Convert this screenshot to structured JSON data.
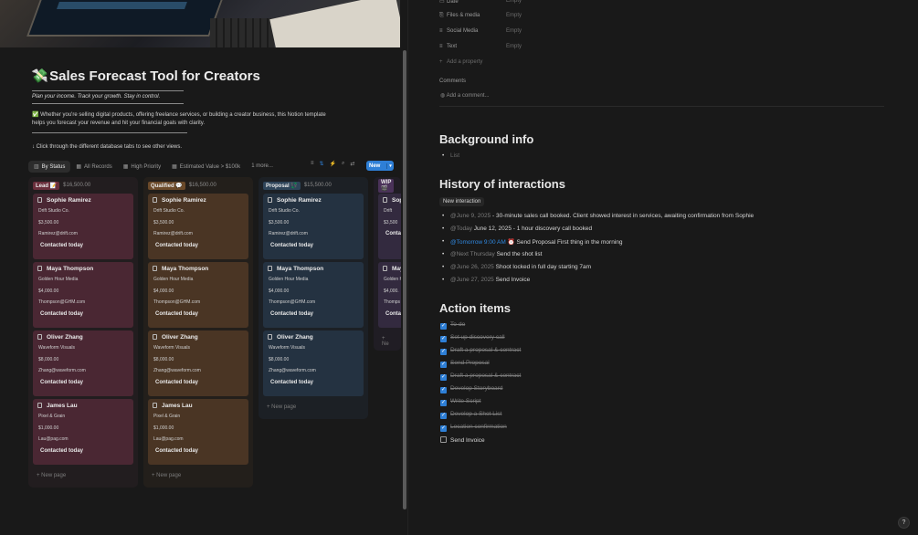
{
  "doc": {
    "title": "Sales Forecast Tool for Creators",
    "tagline": "Plan your income. Track your growth. Stay in control.",
    "description": "Whether you're selling digital products, offering freelance services, or building a creator business, this Notion template helps you forecast your revenue and hit your financial goals with clarity.",
    "hint": "↓ Click through the different database tabs to see other views."
  },
  "tabs": [
    {
      "label": "By Status",
      "icon": "board-icon"
    },
    {
      "label": "All Records",
      "icon": "table-icon"
    },
    {
      "label": "High Priority",
      "icon": "table-icon"
    },
    {
      "label": "Estimated Value > $100k",
      "icon": "table-icon"
    },
    {
      "label": "1 more...",
      "icon": ""
    }
  ],
  "toolbar": {
    "new_label": "New"
  },
  "columns": [
    {
      "label": "Lead 📝",
      "sum": "$16,500.00",
      "pill": "#6a2f3c",
      "card": "#4a2733",
      "bg": "#221d1f",
      "cards": [
        {
          "name": "Sophie Ramirez",
          "company": "Drift Studio Co.",
          "value": "$3,500.00",
          "email": "Ramirez@drift.com",
          "contact": "Contacted today"
        },
        {
          "name": "Maya Thompson",
          "company": "Golden Hour Media",
          "value": "$4,000.00",
          "email": "Thompson@GHM.com",
          "contact": "Contacted today"
        },
        {
          "name": "Oliver Zhang",
          "company": "Waveform Visuals",
          "value": "$8,000.00",
          "email": "Zhang@waveform.com",
          "contact": "Contacted today"
        },
        {
          "name": "James Lau",
          "company": "Pixel & Grain",
          "value": "$1,000.00",
          "email": "Lau@pag.com",
          "contact": "Contacted today"
        }
      ],
      "new_page": "New page"
    },
    {
      "label": "Qualified 💬",
      "sum": "$16,500.00",
      "pill": "#6b4a2a",
      "card": "#4a3524",
      "bg": "#231f1b",
      "cards": [
        {
          "name": "Sophie Ramirez",
          "company": "Drift Studio Co.",
          "value": "$3,500.00",
          "email": "Ramirez@drift.com",
          "contact": "Contacted today"
        },
        {
          "name": "Maya Thompson",
          "company": "Golden Hour Media",
          "value": "$4,000.00",
          "email": "Thompson@GHM.com",
          "contact": "Contacted today"
        },
        {
          "name": "Oliver Zhang",
          "company": "Waveform Visuals",
          "value": "$8,000.00",
          "email": "Zhang@waveform.com",
          "contact": "Contacted today"
        },
        {
          "name": "James Lau",
          "company": "Pixel & Grain",
          "value": "$1,000.00",
          "email": "Lau@pag.com",
          "contact": "Contacted today"
        }
      ],
      "new_page": "New page"
    },
    {
      "label": "Proposal 💱",
      "sum": "$15,500.00",
      "pill": "#2e4459",
      "card": "#243241",
      "bg": "#1c2025",
      "cards": [
        {
          "name": "Sophie Ramirez",
          "company": "Drift Studio Co.",
          "value": "$3,500.00",
          "email": "Ramirez@drift.com",
          "contact": "Contacted today"
        },
        {
          "name": "Maya Thompson",
          "company": "Golden Hour Media",
          "value": "$4,000.00",
          "email": "Thompson@GHM.com",
          "contact": "Contacted today"
        },
        {
          "name": "Oliver Zhang",
          "company": "Waveform Visuals",
          "value": "$8,000.00",
          "email": "Zhang@waveform.com",
          "contact": "Contacted today"
        }
      ],
      "new_page": "New page"
    },
    {
      "label": "WIP 🎬",
      "sum": "",
      "pill": "#4a3259",
      "card": "#332a3f",
      "bg": "#201d24",
      "cards": [
        {
          "name": "Sop",
          "company": "Drift",
          "value": "$3,500",
          "email": "",
          "contact": "Conta"
        },
        {
          "name": "May",
          "company": "Golden H",
          "value": "$4,000.",
          "email": "Thomps",
          "contact": "Conta"
        }
      ],
      "new_page": "Ne"
    }
  ],
  "properties": [
    {
      "label": "Date",
      "value": "Empty",
      "icon": "calendar-icon"
    },
    {
      "label": "Files & media",
      "value": "Empty",
      "icon": "paperclip-icon"
    },
    {
      "label": "Social Media",
      "value": "Empty",
      "icon": "lines-icon"
    },
    {
      "label": "Text",
      "value": "Empty",
      "icon": "lines-icon"
    }
  ],
  "add_property": "Add a property",
  "comments": {
    "heading": "Comments",
    "placeholder": "Add a comment..."
  },
  "background": {
    "heading": "Background info",
    "items": [
      "List"
    ]
  },
  "history": {
    "heading": "History of interactions",
    "button": "New interaction",
    "items": [
      {
        "at": "@June 9, 2025",
        "text": "- 30-minute sales call booked. Client showed interest in services, awaiting confirmation from Sophie"
      },
      {
        "at": "@Today",
        "text": "June 12, 2025 - 1 hour discovery call booked"
      },
      {
        "at": "@Tomorrow 9:00 AM ⏰",
        "text": "Send Proposal First thing in the morning"
      },
      {
        "at": "@Next Thursday",
        "text": "Send the shot list"
      },
      {
        "at": "@June 26, 2025",
        "text": "Shoot locked in full day starting 7am"
      },
      {
        "at": "@June 27, 2025",
        "text": "Send Invoice"
      }
    ]
  },
  "actions": {
    "heading": "Action items",
    "items": [
      {
        "label": "To-do",
        "done": true
      },
      {
        "label": "Set up discovery call",
        "done": true
      },
      {
        "label": "Draft a proposal & contract",
        "done": true
      },
      {
        "label": "Send Proposal",
        "done": true
      },
      {
        "label": "Draft a proposal & contract",
        "done": true
      },
      {
        "label": "Develop Storyboard",
        "done": true
      },
      {
        "label": "Write Script",
        "done": true
      },
      {
        "label": "Develop a Shot List",
        "done": true
      },
      {
        "label": "Location confirmation",
        "done": true
      },
      {
        "label": "Send Invoice",
        "done": false
      }
    ]
  },
  "help_label": "?"
}
